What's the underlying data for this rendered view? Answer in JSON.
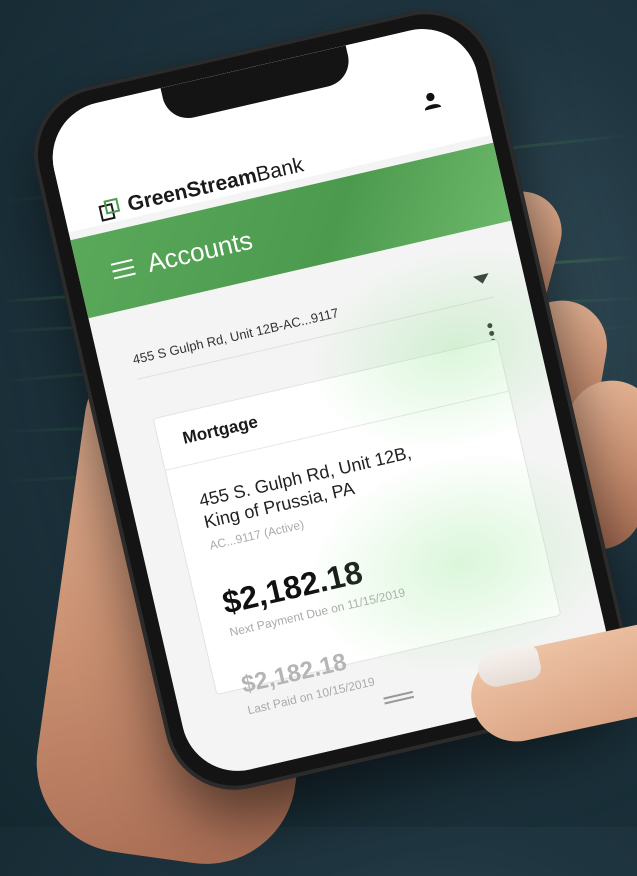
{
  "app": {
    "brand_bold": "GreenStream",
    "brand_light": "Bank"
  },
  "header": {
    "title": "Accounts"
  },
  "account_selector": {
    "value": "455 S Gulph Rd, Unit 12B-AC...9117"
  },
  "card": {
    "title": "Mortgage",
    "address_line1": "455 S. Gulph Rd, Unit 12B,",
    "address_line2": "King of Prussia, PA",
    "account": "AC...9117 (Active)",
    "next_payment_amount": "$2,182.18",
    "next_payment_caption": "Next Payment Due on 11/15/2019",
    "last_paid_amount": "$2,182.18",
    "last_paid_caption": "Last Paid on 10/15/2019"
  },
  "colors": {
    "brand_green": "#4c9a4e",
    "background": "#1f3540"
  },
  "icons": {
    "user": "user-icon",
    "menu": "hamburger-menu-icon",
    "dropdown": "caret-down-icon",
    "more": "kebab-menu-icon",
    "logo": "bank-logo-icon"
  }
}
